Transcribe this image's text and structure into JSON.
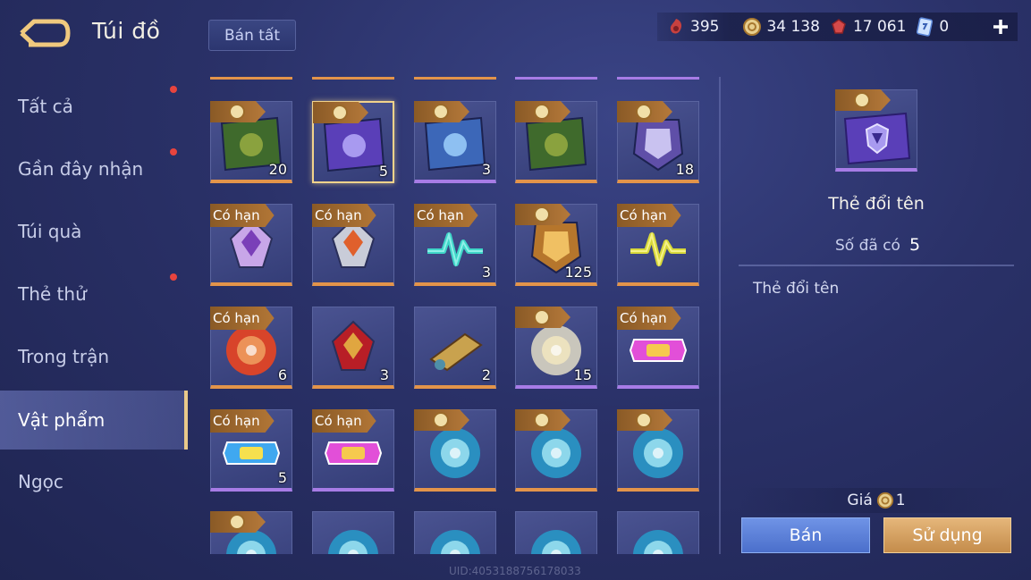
{
  "header": {
    "title": "Túi đồ",
    "sell_all_label": "Bán tất"
  },
  "currencies": [
    {
      "icon": "red-token-icon",
      "value": "395"
    },
    {
      "icon": "gold-coin-icon",
      "value": "34 138"
    },
    {
      "icon": "ruby-gem-icon",
      "value": "17 061"
    },
    {
      "icon": "blue-voucher-icon",
      "value": "0"
    }
  ],
  "sidebar": {
    "items": [
      {
        "label": "Tất cả",
        "dot": true
      },
      {
        "label": "Gần đây nhận",
        "dot": true
      },
      {
        "label": "Túi quà",
        "dot": false
      },
      {
        "label": "Thẻ thử",
        "dot": true
      },
      {
        "label": "Trong trận",
        "dot": false
      },
      {
        "label": "Vật phẩm",
        "dot": false,
        "active": true
      },
      {
        "label": "Ngọc",
        "dot": false
      }
    ]
  },
  "grid": {
    "limited_label": "Có hạn",
    "rows": [
      [
        {
          "art": "gold-x2-card-icon",
          "badge": "coin",
          "count": "20",
          "rarity": "orange"
        },
        {
          "art": "rename-card-icon",
          "badge": "coin",
          "count": "5",
          "rarity": "selected"
        },
        {
          "art": "exp-x2-card-icon",
          "badge": "coin",
          "count": "3",
          "rarity": "purple"
        },
        {
          "art": "gold-x2-card-icon",
          "badge": "coin",
          "count": "",
          "rarity": "orange"
        },
        {
          "art": "helmet-frame-icon",
          "badge": "coin",
          "count": "18",
          "rarity": "orange"
        }
      ],
      [
        {
          "art": "purple-emblem-icon",
          "badge": "limited",
          "count": "",
          "rarity": "orange"
        },
        {
          "art": "orange-gem-emblem-icon",
          "badge": "limited",
          "count": "",
          "rarity": "orange"
        },
        {
          "art": "teal-pulse-icon",
          "badge": "limited",
          "count": "3",
          "rarity": "orange"
        },
        {
          "art": "golden-armor-icon",
          "badge": "coin",
          "count": "125",
          "rarity": "orange"
        },
        {
          "art": "yellow-pulse-icon",
          "badge": "limited",
          "count": "",
          "rarity": "orange"
        }
      ],
      [
        {
          "art": "red-orb-icon",
          "badge": "limited",
          "count": "6",
          "rarity": "orange"
        },
        {
          "art": "ruby-crest-icon",
          "badge": "none",
          "count": "3",
          "rarity": "orange"
        },
        {
          "art": "scroll-icon",
          "badge": "none",
          "count": "2",
          "rarity": "orange"
        },
        {
          "art": "silver-sphere-icon",
          "badge": "coin",
          "count": "15",
          "rarity": "purple"
        },
        {
          "art": "pink-05-ticket-icon",
          "badge": "limited",
          "count": "",
          "rarity": "purple"
        }
      ],
      [
        {
          "art": "blue-2023-ticket-icon",
          "badge": "limited",
          "count": "5",
          "rarity": "purple"
        },
        {
          "art": "pink-04-ticket-icon",
          "badge": "limited",
          "count": "",
          "rarity": "purple"
        },
        {
          "art": "skin-orb-icon",
          "badge": "coin",
          "count": "",
          "rarity": "orange"
        },
        {
          "art": "skin-orb-icon",
          "badge": "coin",
          "count": "",
          "rarity": "orange"
        },
        {
          "art": "skin-orb-icon",
          "badge": "coin",
          "count": "",
          "rarity": "orange"
        }
      ],
      [
        {
          "art": "skin-orb-icon",
          "badge": "coin",
          "count": "",
          "rarity": "orange"
        },
        {
          "art": "skin-orb-icon",
          "badge": "none",
          "count": "",
          "rarity": "orange"
        },
        {
          "art": "skin-orb-icon",
          "badge": "none",
          "count": "",
          "rarity": "orange"
        },
        {
          "art": "skin-orb-icon",
          "badge": "none",
          "count": "",
          "rarity": "orange"
        },
        {
          "art": "skin-orb-icon",
          "badge": "none",
          "count": "",
          "rarity": "orange"
        }
      ]
    ]
  },
  "detail": {
    "name": "Thẻ đổi tên",
    "owned_label": "Số đã có",
    "owned_value": "5",
    "description": "Thẻ đổi tên",
    "price_label": "Giá",
    "price_value": "1",
    "sell_label": "Bán",
    "use_label": "Sử dụng"
  },
  "footer": {
    "uid": "UID:4053188756178033"
  },
  "colors": {
    "accent_gold": "#e9c98a",
    "rarity_orange": "#e3944a",
    "rarity_purple": "#a77ce6",
    "sell_blue": "#5b80d8",
    "use_orange": "#d6a263"
  }
}
